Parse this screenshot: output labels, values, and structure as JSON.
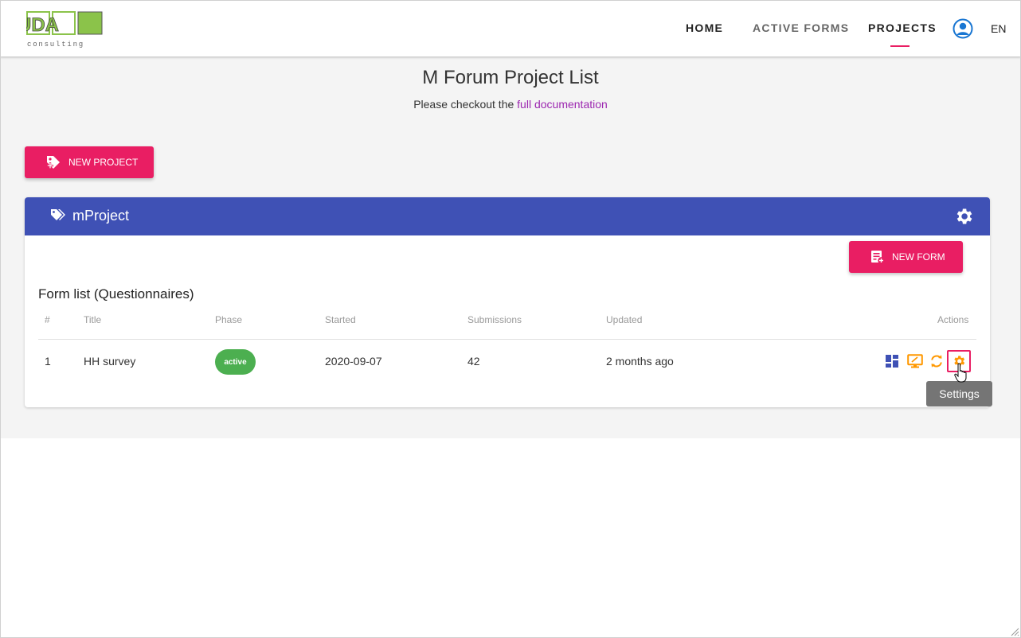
{
  "brand": {
    "logo_text": "UDA",
    "logo_subtext": "consulting"
  },
  "nav": {
    "home": "HOME",
    "active_forms": "ACTIVE FORMS",
    "projects": "PROJECTS",
    "lang": "EN"
  },
  "page": {
    "title": "M Forum Project List",
    "subtitle_prefix": "Please checkout the",
    "doc_link": "full documentation",
    "new_project_label": "NEW PROJECT"
  },
  "project": {
    "name": "mProject",
    "new_form_label": "NEW FORM",
    "form_list_title": "Form list (Questionnaires)",
    "columns": [
      "#",
      "Title",
      "Phase",
      "Started",
      "Submissions",
      "Updated",
      "Actions"
    ],
    "rows": [
      {
        "index": "1",
        "title": "HH survey",
        "phase": "active",
        "started": "2020-09-07",
        "submissions": "42",
        "updated": "2 months ago"
      }
    ]
  },
  "tooltip": {
    "text": "Settings"
  },
  "colors": {
    "accent": "#e91e63",
    "header": "#3f51b5",
    "active_badge": "#4caf50",
    "action_orange": "#ff9800",
    "link": "#9c27b0"
  },
  "icons": {
    "logo": "uda-logo",
    "user": "user-circle-icon",
    "new_project": "tag-plus-icon",
    "project": "tags-icon",
    "project_settings": "gear-icon",
    "new_form": "form-plus-icon",
    "actions": [
      "dashboard-icon",
      "monitor-icon",
      "refresh-icon",
      "gear-icon"
    ]
  }
}
